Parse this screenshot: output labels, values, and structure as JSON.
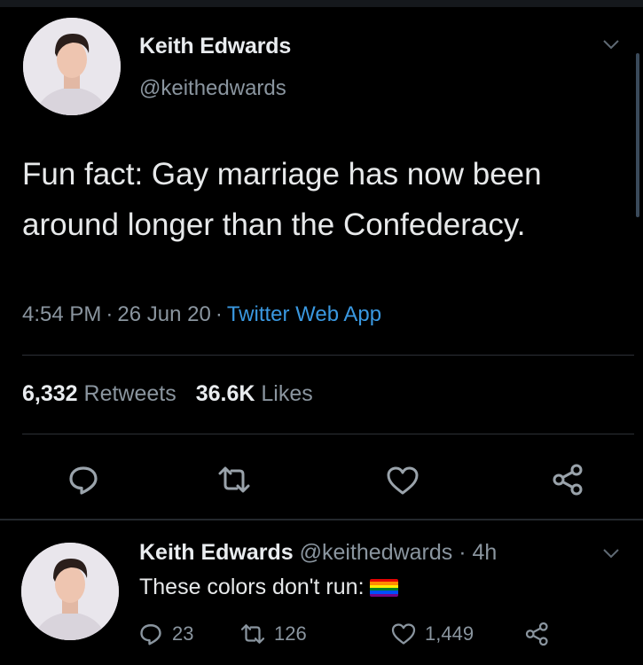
{
  "tweet": {
    "author_name": "Keith Edwards",
    "author_handle": "@keithedwards",
    "text": "Fun fact: Gay marriage has now been around longer than the Confederacy.",
    "time": "4:54 PM",
    "separator": "·",
    "date": "26 Jun 20",
    "source": "Twitter Web App",
    "retweets_count": "6,332",
    "retweets_label": "Retweets",
    "likes_count": "36.6K",
    "likes_label": "Likes"
  },
  "reply": {
    "author_name": "Keith Edwards",
    "author_handle": "@keithedwards",
    "age": "· 4h",
    "text": "These colors don't run:",
    "reply_count": "23",
    "retweet_count": "126",
    "like_count": "1,449"
  },
  "icons": {
    "reply": "comment-icon",
    "retweet": "retweet-icon",
    "like": "heart-icon",
    "share": "share-icon",
    "more": "chevron-down-icon",
    "flag": "rainbow-flag-emoji"
  },
  "colors": {
    "background": "#000000",
    "text_primary": "#e7e9ea",
    "text_secondary": "#8a959f",
    "link": "#3a98e0",
    "divider": "#2c3036"
  }
}
